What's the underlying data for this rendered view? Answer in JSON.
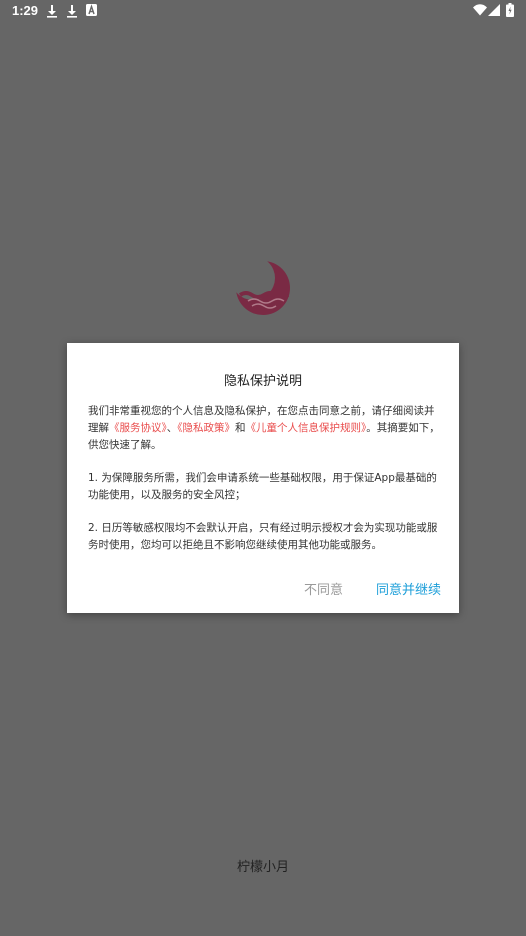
{
  "status_bar": {
    "time": "1:29",
    "notification_icons": [
      "download-icon",
      "download-icon",
      "a-notification-icon"
    ],
    "system_icons": [
      "wifi-icon",
      "signal-icon",
      "battery-icon"
    ]
  },
  "app": {
    "name": "柠檬小月",
    "logo_icon": "moon-waves-logo-icon",
    "logo_color": "#7a2a44"
  },
  "dialog": {
    "title": "隐私保护说明",
    "intro_prefix": "我们非常重视您的个人信息及隐私保护，在您点击同意之前，请仔细阅读并理解",
    "link_service": "《服务协议》",
    "separator": "、",
    "link_privacy": "《隐私政策》",
    "and": "和",
    "link_children": "《儿童个人信息保护规则》",
    "intro_suffix": "。其摘要如下，供您快速了解。",
    "point1": "1. 为保障服务所需，我们会申请系统一些基础权限，用于保证App最基础的功能使用，以及服务的安全风控；",
    "point2": "2. 日历等敏感权限均不会默认开启，只有经过明示授权才会为实现功能或服务时使用，您均可以拒绝且不影响您继续使用其他功能或服务。",
    "disagree_label": "不同意",
    "agree_label": "同意并继续",
    "link_color": "#e94b4b",
    "agree_color": "#1e9fd9"
  }
}
